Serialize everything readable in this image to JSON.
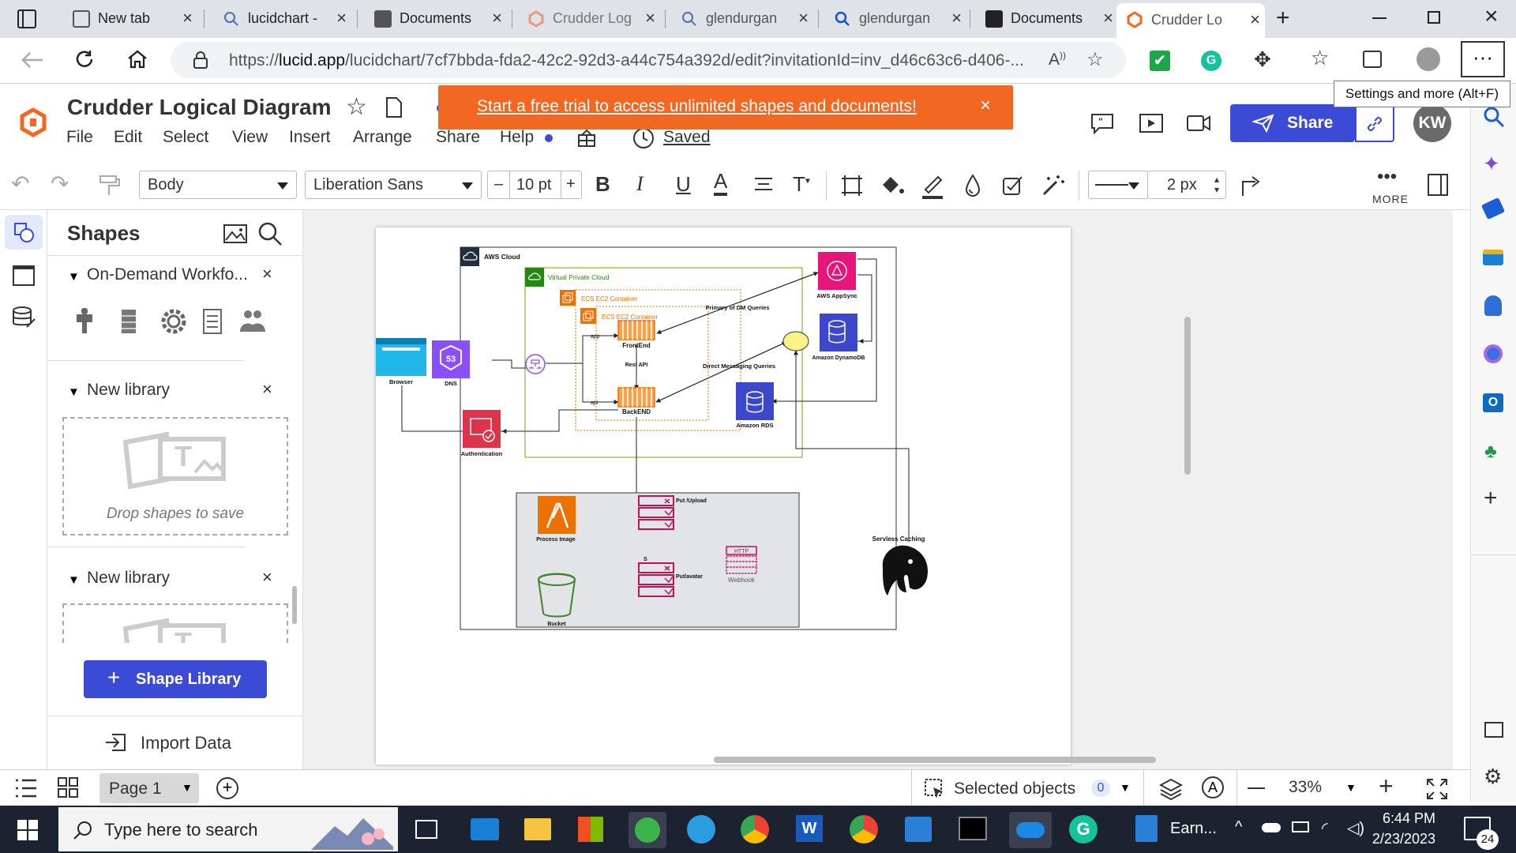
{
  "browser": {
    "tabs": [
      {
        "label": "New tab",
        "icon": "new-tab-icon"
      },
      {
        "label": "lucidchart -",
        "icon": "search-icon"
      },
      {
        "label": "Documents",
        "icon": "lucid-doc-icon"
      },
      {
        "label": "Crudder Log",
        "icon": "lucid-logo-icon"
      },
      {
        "label": "glendurgan",
        "icon": "search-icon"
      },
      {
        "label": "glendurgan",
        "icon": "search-icon"
      },
      {
        "label": "Documents",
        "icon": "lucid-doc-icon"
      },
      {
        "label": "Crudder Lo",
        "icon": "lucid-logo-icon",
        "active": true
      }
    ],
    "url_prefix": "https://",
    "url_domain": "lucid.app",
    "url_rest": "/lucidchart/7cf7bbda-fda2-42c2-92d3-a44c754a392d/edit?invitationId=inv_d46c63c6-d406-...",
    "tooltip": "Settings and more (Alt+F)"
  },
  "app": {
    "title": "Crudder Logical  Diagram",
    "menu": [
      "File",
      "Edit",
      "Select",
      "View",
      "Insert",
      "Arrange",
      "Share",
      "Help"
    ],
    "saved": "Saved",
    "banner": "Start a free trial to access unlimited shapes and documents!",
    "banner_close": "×",
    "share_label": "Share",
    "avatar_initials": "KW",
    "brand_color": "#f26722",
    "accent_color": "#3c4bd6"
  },
  "toolbar": {
    "style_value": "Body",
    "font_value": "Liberation Sans",
    "font_size": "10 pt",
    "minus": "–",
    "plus": "+",
    "line_width": "2 px",
    "more_label": "MORE"
  },
  "shapes_panel": {
    "title": "Shapes",
    "libraries": [
      {
        "name": "On-Demand Workfo...",
        "close": "×"
      },
      {
        "name": "New library",
        "close": "×",
        "drop_text": "Drop shapes to save"
      },
      {
        "name": "New library",
        "close": "×"
      }
    ],
    "shape_library_button": "Shape Library",
    "import_data": "Import Data"
  },
  "diagram": {
    "aws_cloud": "AWS Cloud",
    "vpc": "Virtual Private Cloud",
    "ecs_outer": "ECS EC2 Container",
    "ecs_inner": "ECS EC2 Container",
    "frontend": "FrontEnd",
    "backend": "BackEND",
    "app_label": "app",
    "api_label": "api",
    "rest_api": "Rest API",
    "browser": "Browser",
    "dns": "DNS",
    "dns_badge": "53",
    "authentication": "Authentication",
    "appsync": "AWS AppSync",
    "dynamodb": "Amazon DynamoDB",
    "rds": "Amazon RDS",
    "primary_dm": "Primary of DM Queries",
    "direct_msg": "Direct Messaging Queries",
    "process_image": "Process Image",
    "put_upload": "Put /Upload",
    "put_avatar": "Put/avatar",
    "s_label": "S",
    "bucket": "Bucket",
    "webhook": "Webhook",
    "webhook_badge": "HTTP",
    "serverless": "Servless Caching"
  },
  "bottom": {
    "page_label": "Page 1",
    "selected_objects": "Selected objects",
    "selected_count": "0",
    "zoom": "33%"
  },
  "taskbar": {
    "search_placeholder": "Type here to search",
    "earn": "Earn...",
    "time": "6:44 PM",
    "date": "2/23/2023",
    "notif_count": "24"
  }
}
